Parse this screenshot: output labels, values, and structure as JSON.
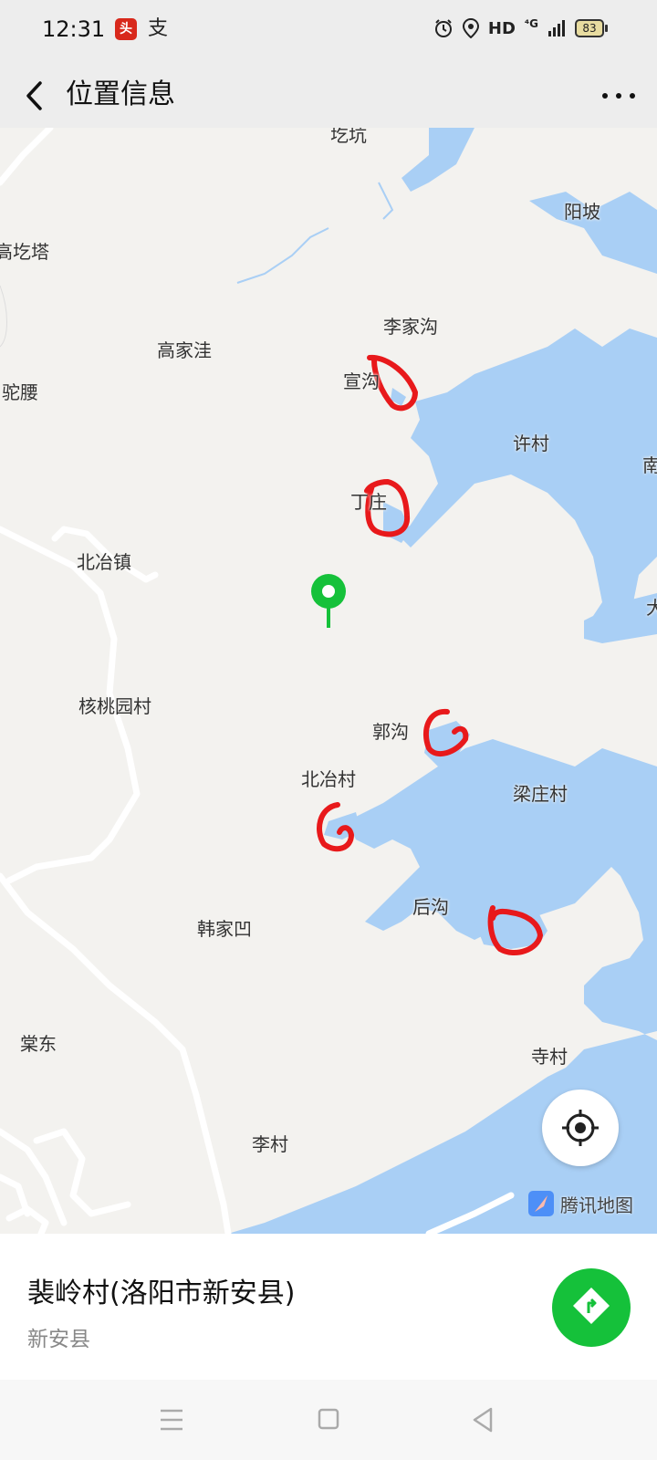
{
  "status_bar": {
    "time": "12:31",
    "app_icons": [
      "头条",
      "支"
    ],
    "right_icons": [
      "alarm-icon",
      "location-icon"
    ],
    "hd": "HD",
    "network": "⁴G",
    "battery": "83"
  },
  "nav": {
    "title": "位置信息",
    "back_icon": "chevron-left-icon",
    "more_icon": "more-icon"
  },
  "map": {
    "labels": [
      "阳坡",
      "高圪塔",
      "李家沟",
      "高家洼",
      "驼腰",
      "宣沟",
      "许村",
      "南",
      "丁庄",
      "北冶镇",
      "核桃园村",
      "郭沟",
      "北冶村",
      "梁庄村",
      "后沟",
      "韩家凹",
      "棠东",
      "寺村",
      "李村",
      "大"
    ],
    "top_label": "圪坑",
    "watermark": "腾讯地图",
    "water_color": "#a9cff5",
    "road_color": "#ffffff",
    "pin_color": "#15c13a",
    "annotation_color": "#e8191b"
  },
  "info": {
    "title": "裴岭村(洛阳市新安县)",
    "subtitle": "新安县"
  },
  "system_nav": [
    "menu-icon",
    "home-icon",
    "back-icon"
  ]
}
